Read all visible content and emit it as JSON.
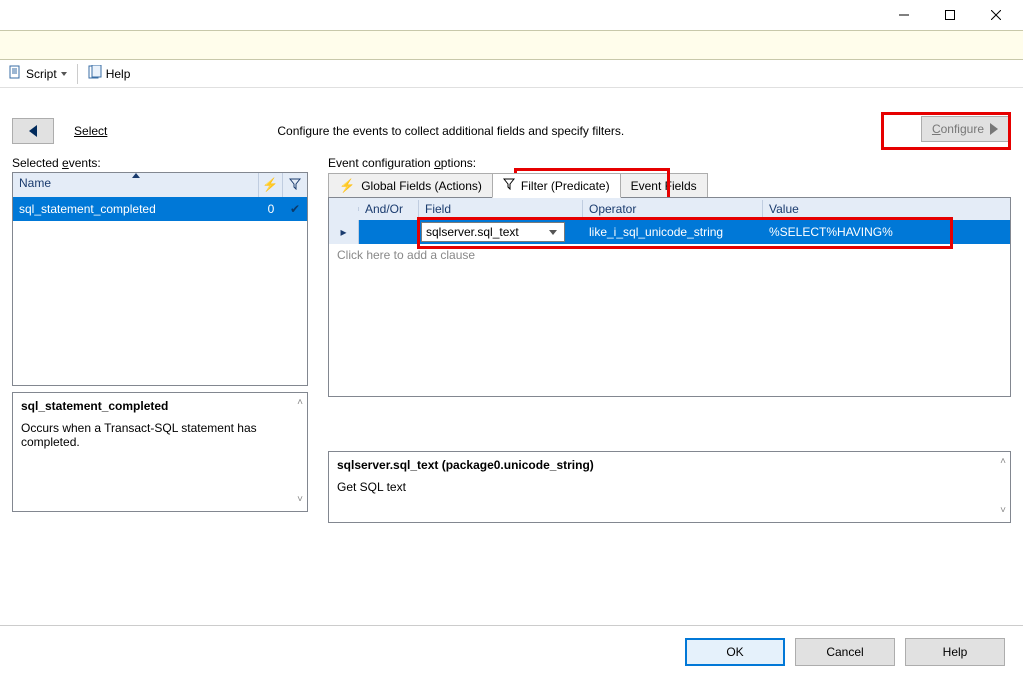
{
  "window_controls": {
    "minimize": "–",
    "maximize": "▢",
    "close": "✕"
  },
  "toolbar": {
    "script_label": "Script",
    "help_label": "Help"
  },
  "nav": {
    "select_label": "Select",
    "configure_label": "Configure",
    "description": "Configure the events to collect additional fields and specify filters."
  },
  "left": {
    "section_title": "Selected events:",
    "columns": {
      "name": "Name"
    },
    "rows": [
      {
        "name": "sql_statement_completed",
        "count": "0",
        "checked": true
      }
    ],
    "desc_title": "sql_statement_completed",
    "desc_body": "Occurs when a Transact-SQL statement has completed."
  },
  "right": {
    "section_title": "Event configuration options:",
    "tabs": {
      "global": "Global Fields (Actions)",
      "filter": "Filter (Predicate)",
      "event_fields": "Event Fields"
    },
    "filter_headers": {
      "andor": "And/Or",
      "field": "Field",
      "operator": "Operator",
      "value": "Value"
    },
    "filter_row": {
      "field": "sqlserver.sql_text",
      "operator": "like_i_sql_unicode_string",
      "value": "%SELECT%HAVING%"
    },
    "add_clause": "Click here to add a clause",
    "field_desc_title": "sqlserver.sql_text (package0.unicode_string)",
    "field_desc_body": "Get SQL text"
  },
  "footer": {
    "ok": "OK",
    "cancel": "Cancel",
    "help": "Help"
  }
}
